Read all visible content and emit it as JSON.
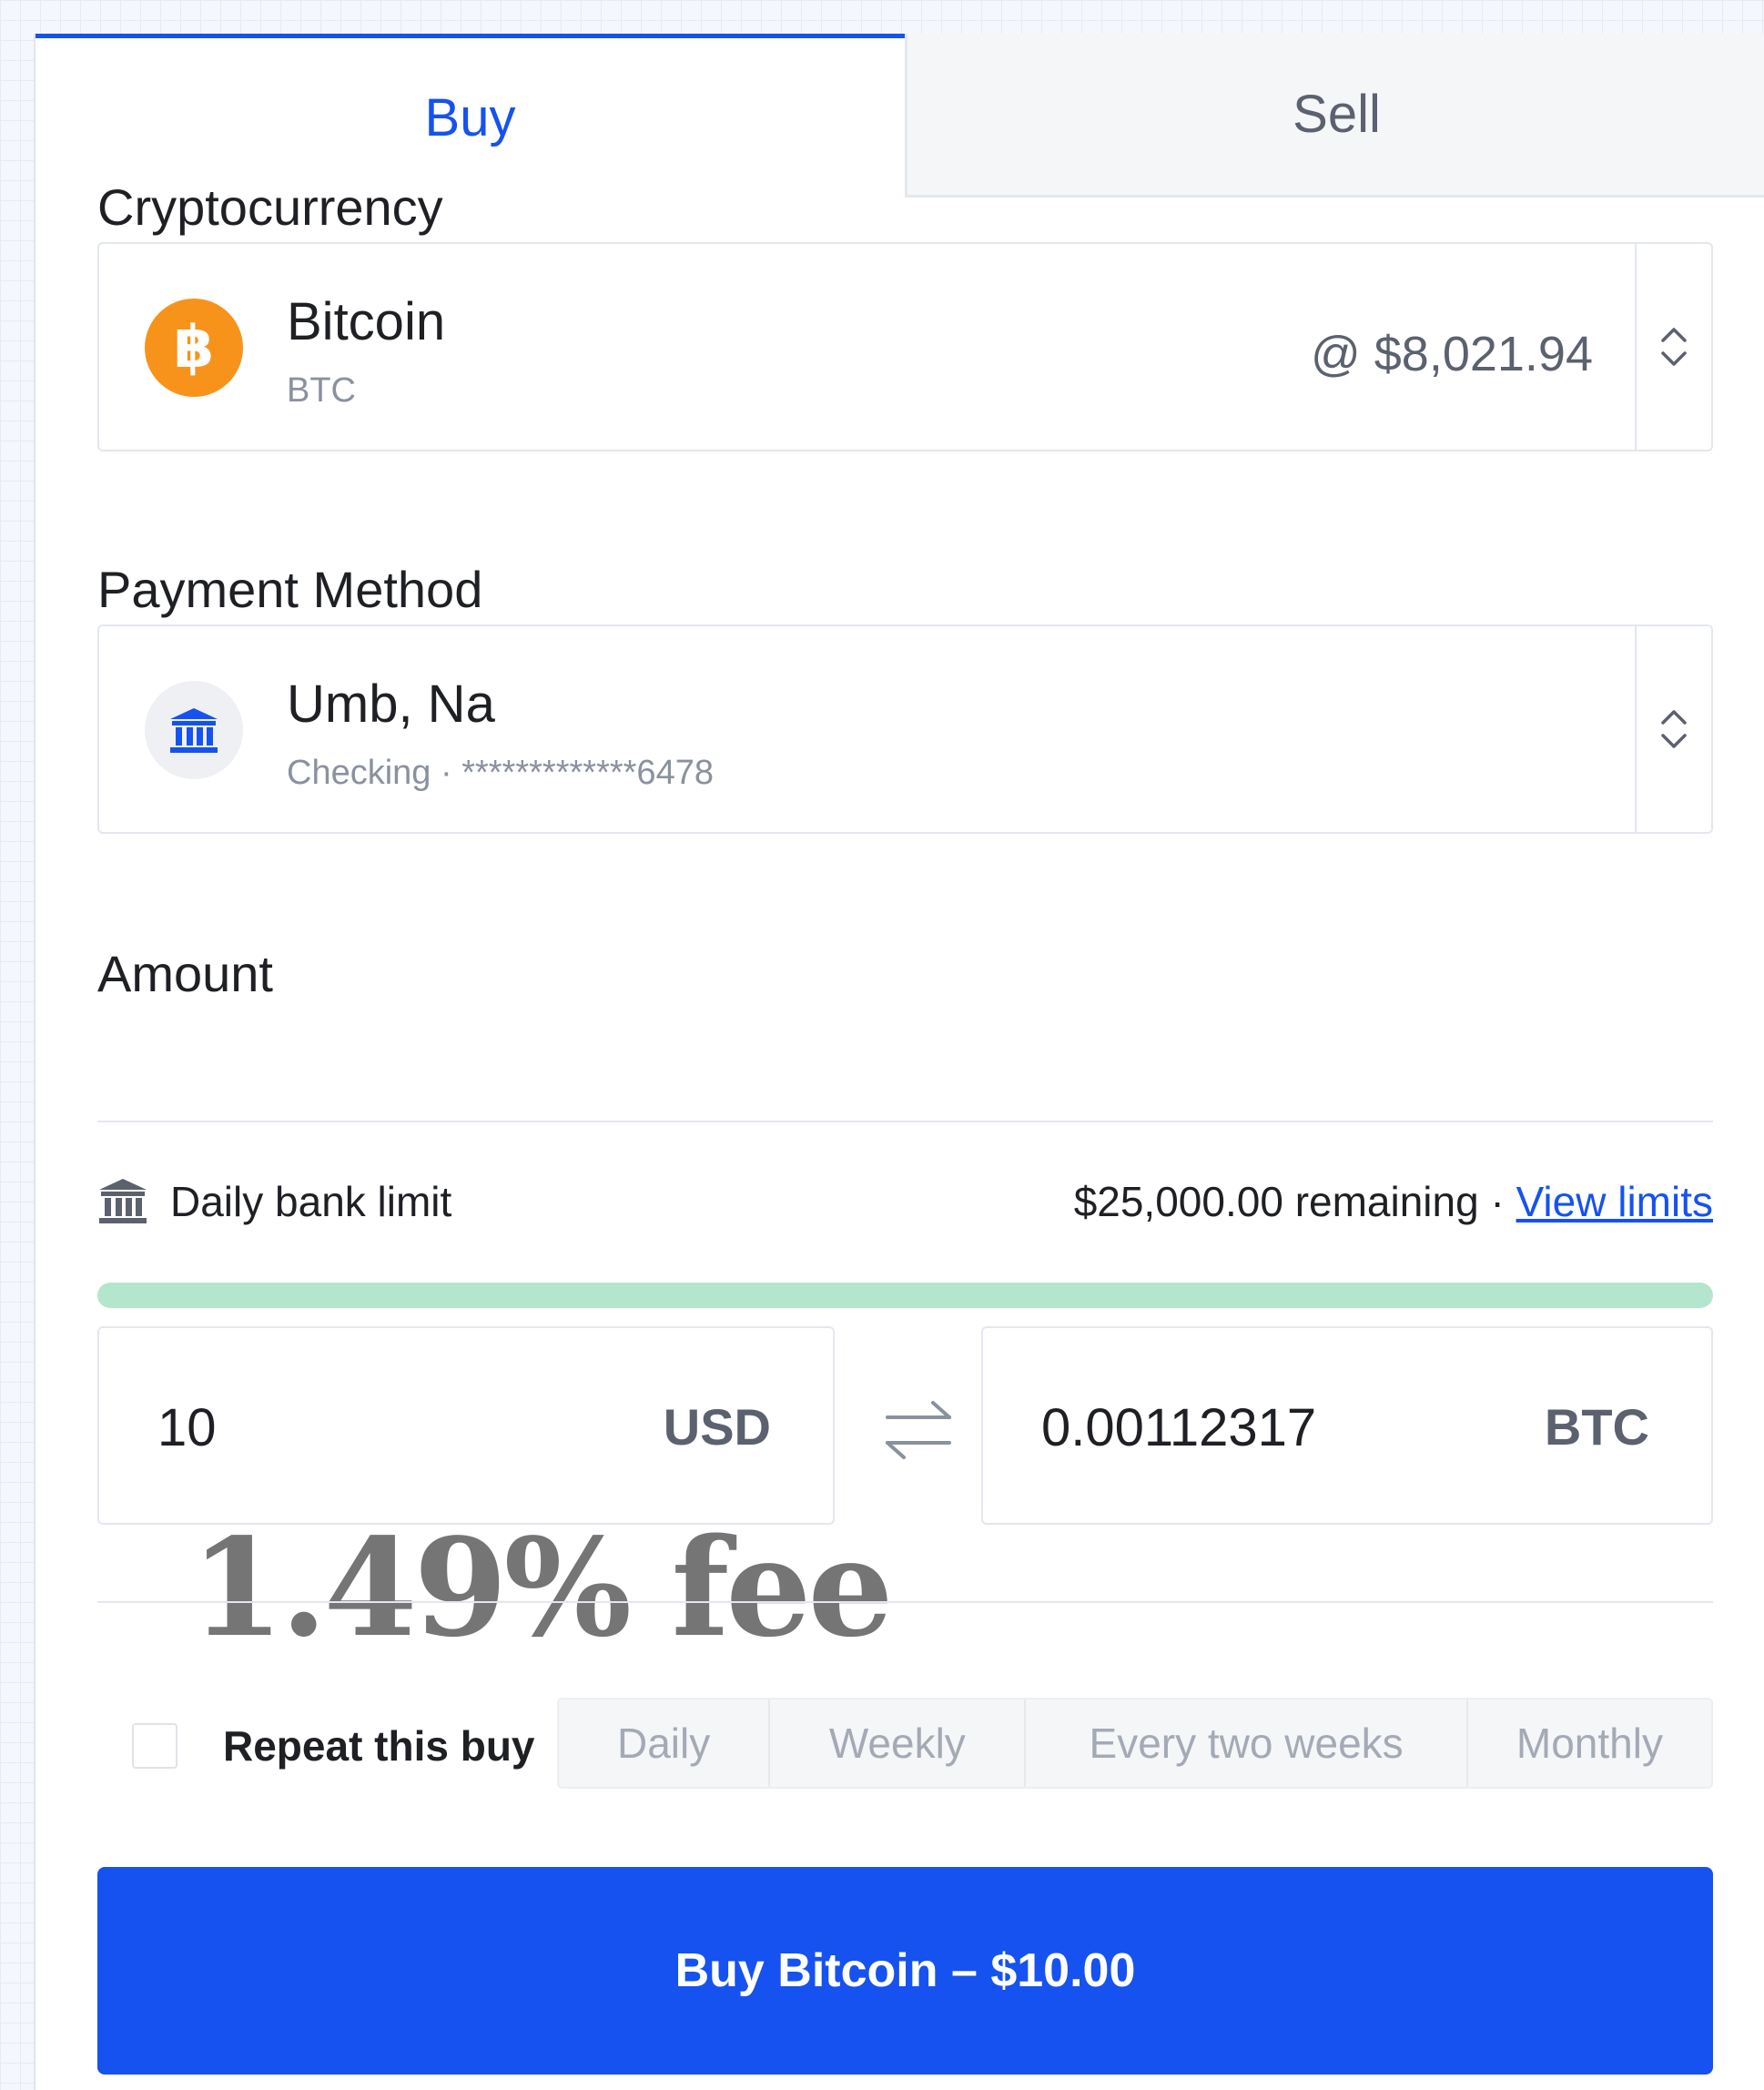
{
  "tabs": {
    "buy": "Buy",
    "sell": "Sell"
  },
  "crypto": {
    "label": "Cryptocurrency",
    "name": "Bitcoin",
    "symbol": "BTC",
    "price": "@ $8,021.94",
    "icon": "bitcoin-icon",
    "icon_glyph": "฿",
    "icon_color": "#f7931a"
  },
  "payment": {
    "label": "Payment Method",
    "name": "Umb, Na",
    "account": "Checking · *************6478",
    "icon": "bank-icon"
  },
  "amount": {
    "label": "Amount",
    "limit_label": "Daily bank limit",
    "limit_remaining": "$25,000.00 remaining",
    "separator": " · ",
    "limit_link": "View limits",
    "limit_progress": 1.0,
    "fiat_value": "10",
    "fiat_unit": "USD",
    "crypto_value": "0.00112317",
    "crypto_unit": "BTC"
  },
  "annotation": "1.49% fee",
  "repeat": {
    "label": "Repeat this buy",
    "options": [
      "Daily",
      "Weekly",
      "Every two weeks",
      "Monthly"
    ]
  },
  "submit_label": "Buy Bitcoin – $10.00",
  "colors": {
    "accent": "#1652f0",
    "progress": "#b3e6cc",
    "text": "#1e2024",
    "muted": "#8a919e"
  }
}
